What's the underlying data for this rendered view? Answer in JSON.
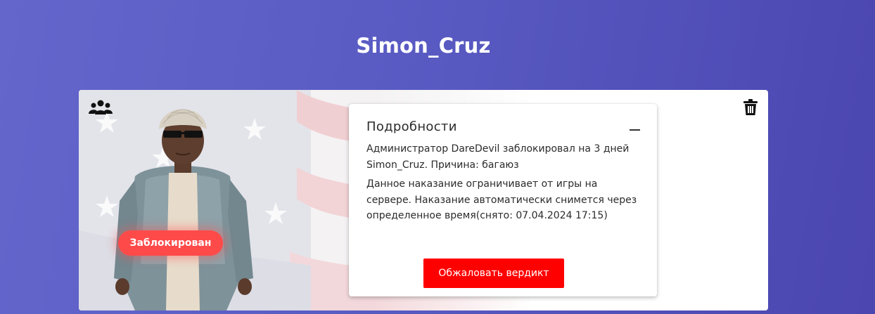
{
  "header": {
    "username": "Simon_Cruz"
  },
  "card": {
    "group_icon": "users-group-icon",
    "delete_icon": "trash-icon",
    "status_badge": "Заблокирован",
    "details": {
      "title": "Подробности",
      "collapse_icon": "minus-icon",
      "ban_message": "Администратор DareDevil заблокировал на 3 дней Simon_Cruz. Причина: багаюз",
      "ban_info": "Данное наказание ограничивает от игры на сервере. Наказание автоматически снимется через определенное время(снято: 07.04.2024 17:15)",
      "appeal_button": "Обжаловать вердикт"
    }
  },
  "colors": {
    "background_start": "#6466cc",
    "background_end": "#4b46b0",
    "badge": "#ff4a4a",
    "appeal_button": "#ff0000"
  }
}
